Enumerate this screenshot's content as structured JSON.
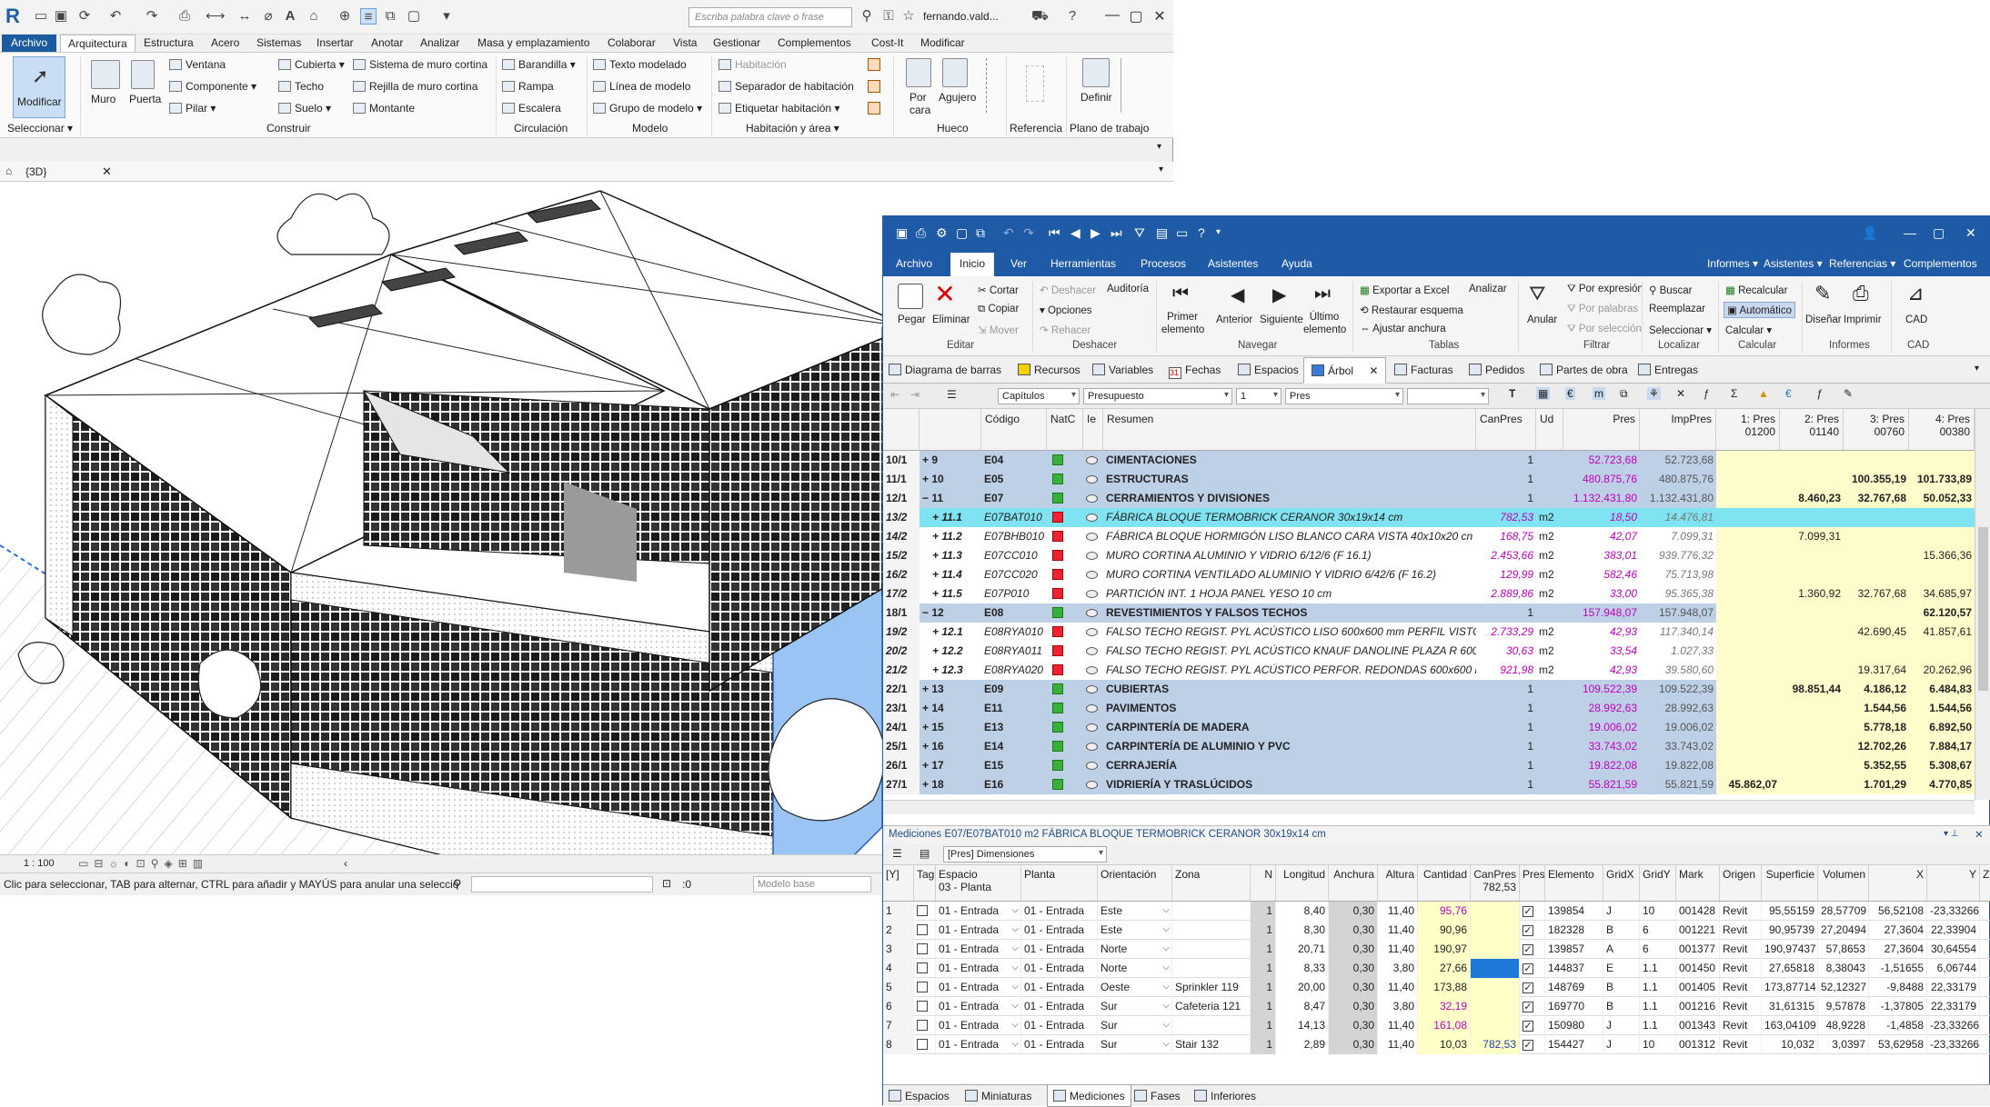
{
  "revit": {
    "search_placeholder": "Escriba palabra clave o frase",
    "user": "fernando.vald...",
    "tabs": [
      "Archivo",
      "Arquitectura",
      "Estructura",
      "Acero",
      "Sistemas",
      "Insertar",
      "Anotar",
      "Analizar",
      "Masa y emplazamiento",
      "Colaborar",
      "Vista",
      "Gestionar",
      "Complementos",
      "Cost-It",
      "Modificar"
    ],
    "ribbon": {
      "modify": "Modificar",
      "select": "Seleccionar",
      "muro": "Muro",
      "puerta": "Puerta",
      "ventana": "Ventana",
      "componente": "Componente",
      "pilar": "Pilar",
      "cubierta": "Cubierta",
      "techo": "Techo",
      "suelo": "Suelo",
      "sistema_muro": "Sistema de muro cortina",
      "rejilla": "Rejilla de muro cortina",
      "montante": "Montante",
      "construir": "Construir",
      "barandilla": "Barandilla",
      "rampa": "Rampa",
      "escalera": "Escalera",
      "circulacion": "Circulación",
      "texto_modelado": "Texto modelado",
      "linea_modelo": "Línea de modelo",
      "grupo_modelo": "Grupo de modelo",
      "modelo": "Modelo",
      "habitacion": "Habitación",
      "separador": "Separador de habitación",
      "etiquetar": "Etiquetar  habitación",
      "hab_area": "Habitación y área",
      "por_cara": "Por cara",
      "agujero": "Agujero",
      "hueco": "Hueco",
      "referencia": "Referencia",
      "definir": "Definir",
      "plano_trabajo": "Plano de trabajo"
    },
    "view_tab": "{3D}",
    "scale": "1 : 100",
    "status": "Clic para seleccionar, TAB para alternar, CTRL para añadir y MAYÚS para anular una selecció",
    "coord": ":0",
    "model_base": "Modelo base"
  },
  "presto": {
    "menu": [
      "Archivo",
      "Inicio",
      "Ver",
      "Herramientas",
      "Procesos",
      "Asistentes",
      "Ayuda"
    ],
    "menu_right": [
      "Informes",
      "Asistentes",
      "Referencias",
      "Complementos"
    ],
    "ribbon": {
      "pegar": "Pegar",
      "eliminar": "Eliminar",
      "cortar": "Cortar",
      "copiar": "Copiar",
      "mover": "Mover",
      "editar": "Editar",
      "deshacer": "Deshacer",
      "auditoria": "Auditoría",
      "opciones": "Opciones",
      "rehacer": "Rehacer",
      "deshacer_g": "Deshacer",
      "primer": "Primer elemento",
      "anterior": "Anterior",
      "siguiente": "Siguiente",
      "ultimo": "Último elemento",
      "navegar": "Navegar",
      "exportar": "Exportar a Excel",
      "restaurar": "Restaurar esquema",
      "ajustar": "Ajustar anchura",
      "analizar": "Analizar",
      "tablas": "Tablas",
      "anular": "Anular",
      "por_expresion": "Por expresión",
      "por_palabras": "Por palabras",
      "por_seleccion": "Por selección",
      "filtrar": "Filtrar",
      "buscar": "Buscar",
      "reemplazar": "Reemplazar",
      "seleccionar": "Seleccionar",
      "localizar": "Localizar",
      "recalcular": "Recalcular",
      "automatico": "Automático",
      "calcular": "Calcular",
      "calcular_g": "Calcular",
      "disenar": "Diseñar",
      "imprimir": "Imprimir",
      "informes": "Informes",
      "cad": "CAD",
      "cad_g": "CAD"
    },
    "tabs": [
      "Diagrama de barras",
      "Recursos",
      "Variables",
      "Fechas",
      "Espacios",
      "Árbol",
      "Facturas",
      "Pedidos",
      "Partes de obra",
      "Entregas"
    ],
    "tool": {
      "capitulos": "Capítulos",
      "presupuesto": "Presupuesto",
      "level": "1",
      "pres": "Pres"
    },
    "tree_headers": {
      "codigo": "Código",
      "natc": "NatC",
      "ie": "Ie",
      "resumen": "Resumen",
      "canpres": "CanPres",
      "ud": "Ud",
      "pres": "Pres",
      "imppres": "ImpPres",
      "p1": "1: Pres",
      "p1b": "01200",
      "p2": "2: Pres",
      "p2b": "01140",
      "p3": "3: Pres",
      "p3b": "00760",
      "p4": "4: Pres",
      "p4b": "00380"
    },
    "tree_rows": [
      {
        "ix": "10/1",
        "pos": "+ 9",
        "cod": "E04",
        "res": "CIMENTACIONES",
        "can": "1",
        "ud": "",
        "pres": "52.723,68",
        "imp": "52.723,68",
        "p1": "",
        "p2": "",
        "p3": "",
        "p4": "",
        "k": "chap"
      },
      {
        "ix": "11/1",
        "pos": "+ 10",
        "cod": "E05",
        "res": "ESTRUCTURAS",
        "can": "1",
        "ud": "",
        "pres": "480.875,76",
        "imp": "480.875,76",
        "p1": "",
        "p2": "",
        "p3": "100.355,19",
        "p4": "101.733,89",
        "k": "chap"
      },
      {
        "ix": "12/1",
        "pos": "− 11",
        "cod": "E07",
        "res": "CERRAMIENTOS Y DIVISIONES",
        "can": "1",
        "ud": "",
        "pres": "1.132.431,80",
        "imp": "1.132.431,80",
        "p1": "",
        "p2": "8.460,23",
        "p3": "32.767,68",
        "p4": "50.052,33",
        "k": "chap"
      },
      {
        "ix": "13/2",
        "pos": "+ 11.1",
        "cod": "E07BAT010",
        "res": "FÁBRICA BLOQUE TERMOBRICK CERANOR 30x19x14 cm",
        "can": "782,53",
        "ud": "m2",
        "pres": "18,50",
        "imp": "14.476,81",
        "p1": "",
        "p2": "",
        "p3": "",
        "p4": "",
        "k": "sel"
      },
      {
        "ix": "14/2",
        "pos": "+ 11.2",
        "cod": "E07BHB010",
        "res": "FÁBRICA BLOQUE HORMIGÓN LISO BLANCO CARA VISTA 40x10x20 cn",
        "can": "168,75",
        "ud": "m2",
        "pres": "42,07",
        "imp": "7.099,31",
        "p1": "",
        "p2": "7.099,31",
        "p3": "",
        "p4": "",
        "k": "item"
      },
      {
        "ix": "15/2",
        "pos": "+ 11.3",
        "cod": "E07CC010",
        "res": "MURO CORTINA ALUMINIO Y VIDRIO 6/12/6 (F 16.1)",
        "can": "2.453,66",
        "ud": "m2",
        "pres": "383,01",
        "imp": "939.776,32",
        "p1": "",
        "p2": "",
        "p3": "",
        "p4": "15.366,36",
        "k": "item"
      },
      {
        "ix": "16/2",
        "pos": "+ 11.4",
        "cod": "E07CC020",
        "res": "MURO CORTINA VENTILADO ALUMINIO Y VIDRIO 6/42/6 (F 16.2)",
        "can": "129,99",
        "ud": "m2",
        "pres": "582,46",
        "imp": "75.713,98",
        "p1": "",
        "p2": "",
        "p3": "",
        "p4": "",
        "k": "item"
      },
      {
        "ix": "17/2",
        "pos": "+ 11.5",
        "cod": "E07P010",
        "res": "PARTICIÓN INT. 1 HOJA PANEL YESO 10 cm",
        "can": "2.889,86",
        "ud": "m2",
        "pres": "33,00",
        "imp": "95.365,38",
        "p1": "",
        "p2": "1.360,92",
        "p3": "32.767,68",
        "p4": "34.685,97",
        "k": "item"
      },
      {
        "ix": "18/1",
        "pos": "− 12",
        "cod": "E08",
        "res": "REVESTIMIENTOS Y FALSOS TECHOS",
        "can": "1",
        "ud": "",
        "pres": "157.948,07",
        "imp": "157.948,07",
        "p1": "",
        "p2": "",
        "p3": "",
        "p4": "62.120,57",
        "k": "chap"
      },
      {
        "ix": "19/2",
        "pos": "+ 12.1",
        "cod": "E08RYA010",
        "res": "FALSO TECHO REGIST. PYL ACÚSTICO LISO 600x600 mm PERFIL VISTO",
        "can": "2.733,29",
        "ud": "m2",
        "pres": "42,93",
        "imp": "117.340,14",
        "p1": "",
        "p2": "",
        "p3": "42.690,45",
        "p4": "41.857,61",
        "k": "item"
      },
      {
        "ix": "20/2",
        "pos": "+ 12.2",
        "cod": "E08RYA011",
        "res": "FALSO TECHO REGIST. PYL ACÚSTICO KNAUF DANOLINE PLAZA R 600.",
        "can": "30,63",
        "ud": "m2",
        "pres": "33,54",
        "imp": "1.027,33",
        "p1": "",
        "p2": "",
        "p3": "",
        "p4": "",
        "k": "item"
      },
      {
        "ix": "21/2",
        "pos": "+ 12.3",
        "cod": "E08RYA020",
        "res": "FALSO TECHO REGIST. PYL ACÚSTICO PERFOR. REDONDAS 600x600 m",
        "can": "921,98",
        "ud": "m2",
        "pres": "42,93",
        "imp": "39.580,60",
        "p1": "",
        "p2": "",
        "p3": "19.317,64",
        "p4": "20.262,96",
        "k": "item"
      },
      {
        "ix": "22/1",
        "pos": "+ 13",
        "cod": "E09",
        "res": "CUBIERTAS",
        "can": "1",
        "ud": "",
        "pres": "109.522,39",
        "imp": "109.522,39",
        "p1": "",
        "p2": "98.851,44",
        "p3": "4.186,12",
        "p4": "6.484,83",
        "k": "chap"
      },
      {
        "ix": "23/1",
        "pos": "+ 14",
        "cod": "E11",
        "res": "PAVIMENTOS",
        "can": "1",
        "ud": "",
        "pres": "28.992,63",
        "imp": "28.992,63",
        "p1": "",
        "p2": "",
        "p3": "1.544,56",
        "p4": "1.544,56",
        "k": "chap"
      },
      {
        "ix": "24/1",
        "pos": "+ 15",
        "cod": "E13",
        "res": "CARPINTERÍA DE MADERA",
        "can": "1",
        "ud": "",
        "pres": "19.006,02",
        "imp": "19.006,02",
        "p1": "",
        "p2": "",
        "p3": "5.778,18",
        "p4": "6.892,50",
        "k": "chap"
      },
      {
        "ix": "25/1",
        "pos": "+ 16",
        "cod": "E14",
        "res": "CARPINTERÍA DE ALUMINIO Y PVC",
        "can": "1",
        "ud": "",
        "pres": "33.743,02",
        "imp": "33.743,02",
        "p1": "",
        "p2": "",
        "p3": "12.702,26",
        "p4": "7.884,17",
        "k": "chap"
      },
      {
        "ix": "26/1",
        "pos": "+ 17",
        "cod": "E15",
        "res": "CERRAJERÍA",
        "can": "1",
        "ud": "",
        "pres": "19.822,08",
        "imp": "19.822,08",
        "p1": "",
        "p2": "",
        "p3": "5.352,55",
        "p4": "5.308,67",
        "k": "chap"
      },
      {
        "ix": "27/1",
        "pos": "+ 18",
        "cod": "E16",
        "res": "VIDRIERÍA Y TRASLÚCIDOS",
        "can": "1",
        "ud": "",
        "pres": "55.821,59",
        "imp": "55.821,59",
        "p1": "45.862,07",
        "p2": "",
        "p3": "1.701,29",
        "p4": "4.770,85",
        "k": "chap"
      }
    ],
    "med_title": "Mediciones E07/E07BAT010 m2 FÁBRICA BLOQUE TERMOBRICK CERANOR 30x19x14 cm",
    "med_combo": "[Pres] Dimensiones",
    "med_headers": {
      "y": "[Y]",
      "tag": "Tag",
      "espacio": "Espacio",
      "espacio_sub": "03 - Planta",
      "planta": "Planta",
      "orient": "Orientación",
      "zona": "Zona",
      "n": "N",
      "long": "Longitud",
      "anch": "Anchura",
      "alt": "Altura",
      "cant": "Cantidad",
      "canpres": "CanPres",
      "canpres_sub": "782,53",
      "pres": "Pres",
      "elem": "Elemento",
      "gx": "GridX",
      "gy": "GridY",
      "mark": "Mark",
      "orig": "Origen",
      "sup": "Superficie",
      "vol": "Volumen",
      "x": "X",
      "yy": "Y",
      "z": "Z"
    },
    "med_rows": [
      {
        "n": "1",
        "esp": "01 - Entrada",
        "pl": "01 - Entrada",
        "or": "Este",
        "zona": "",
        "nn": "1",
        "l": "8,40",
        "a": "0,30",
        "h": "11,40",
        "c": "95,76",
        "cp": "",
        "el": "139854",
        "gx": "J",
        "gy": "10",
        "mk": "001428",
        "og": "Revit",
        "s": "95,55159",
        "v": "28,57709",
        "x": "56,52108",
        "y": "-23,33266",
        "cmag": true
      },
      {
        "n": "2",
        "esp": "01 - Entrada",
        "pl": "01 - Entrada",
        "or": "Este",
        "zona": "",
        "nn": "1",
        "l": "8,30",
        "a": "0,30",
        "h": "11,40",
        "c": "90,96",
        "cp": "",
        "el": "182328",
        "gx": "B",
        "gy": "6",
        "mk": "001221",
        "og": "Revit",
        "s": "90,95739",
        "v": "27,20494",
        "x": "27,3604",
        "y": "22,33904",
        "cmag": false
      },
      {
        "n": "3",
        "esp": "01 - Entrada",
        "pl": "01 - Entrada",
        "or": "Norte",
        "zona": "",
        "nn": "1",
        "l": "20,71",
        "a": "0,30",
        "h": "11,40",
        "c": "190,97",
        "cp": "",
        "el": "139857",
        "gx": "A",
        "gy": "6",
        "mk": "001377",
        "og": "Revit",
        "s": "190,97437",
        "v": "57,8653",
        "x": "27,3604",
        "y": "30,64554",
        "cmag": false
      },
      {
        "n": "4",
        "esp": "01 - Entrada",
        "pl": "01 - Entrada",
        "or": "Norte",
        "zona": "",
        "nn": "1",
        "l": "8,33",
        "a": "0,30",
        "h": "3,80",
        "c": "27,66",
        "cp": "",
        "el": "144837",
        "gx": "E",
        "gy": "1.1",
        "mk": "001450",
        "og": "Revit",
        "s": "27,65818",
        "v": "8,38043",
        "x": "-1,51655",
        "y": "6,06744",
        "cmag": false
      },
      {
        "n": "5",
        "esp": "01 - Entrada",
        "pl": "01 - Entrada",
        "or": "Oeste",
        "zona": "Sprinkler 119",
        "nn": "1",
        "l": "20,00",
        "a": "0,30",
        "h": "11,40",
        "c": "173,88",
        "cp": "",
        "el": "148769",
        "gx": "B",
        "gy": "1.1",
        "mk": "001405",
        "og": "Revit",
        "s": "173,87714",
        "v": "52,12327",
        "x": "-9,8488",
        "y": "22,33179",
        "cmag": false
      },
      {
        "n": "6",
        "esp": "01 - Entrada",
        "pl": "01 - Entrada",
        "or": "Sur",
        "zona": "Cafeteria 121",
        "nn": "1",
        "l": "8,47",
        "a": "0,30",
        "h": "3,80",
        "c": "32,19",
        "cp": "",
        "el": "169770",
        "gx": "B",
        "gy": "1.1",
        "mk": "001216",
        "og": "Revit",
        "s": "31,61315",
        "v": "9,57878",
        "x": "-1,37805",
        "y": "22,33179",
        "cmag": true
      },
      {
        "n": "7",
        "esp": "01 - Entrada",
        "pl": "01 - Entrada",
        "or": "Sur",
        "zona": "",
        "nn": "1",
        "l": "14,13",
        "a": "0,30",
        "h": "11,40",
        "c": "161,08",
        "cp": "",
        "el": "150980",
        "gx": "J",
        "gy": "1.1",
        "mk": "001343",
        "og": "Revit",
        "s": "163,04109",
        "v": "48,9228",
        "x": "-1,4858",
        "y": "-23,33266",
        "cmag": true
      },
      {
        "n": "8",
        "esp": "01 - Entrada",
        "pl": "01 - Entrada",
        "or": "Sur",
        "zona": "Stair 132",
        "nn": "1",
        "l": "2,89",
        "a": "0,30",
        "h": "11,40",
        "c": "10,03",
        "cp": "782,53",
        "el": "154427",
        "gx": "J",
        "gy": "10",
        "mk": "001312",
        "og": "Revit",
        "s": "10,032",
        "v": "3,0397",
        "x": "53,62958",
        "y": "-23,33266",
        "cmag": false
      }
    ],
    "bottom_tabs": [
      "Espacios",
      "Miniaturas",
      "Mediciones",
      "Fases",
      "Inferiores"
    ]
  }
}
